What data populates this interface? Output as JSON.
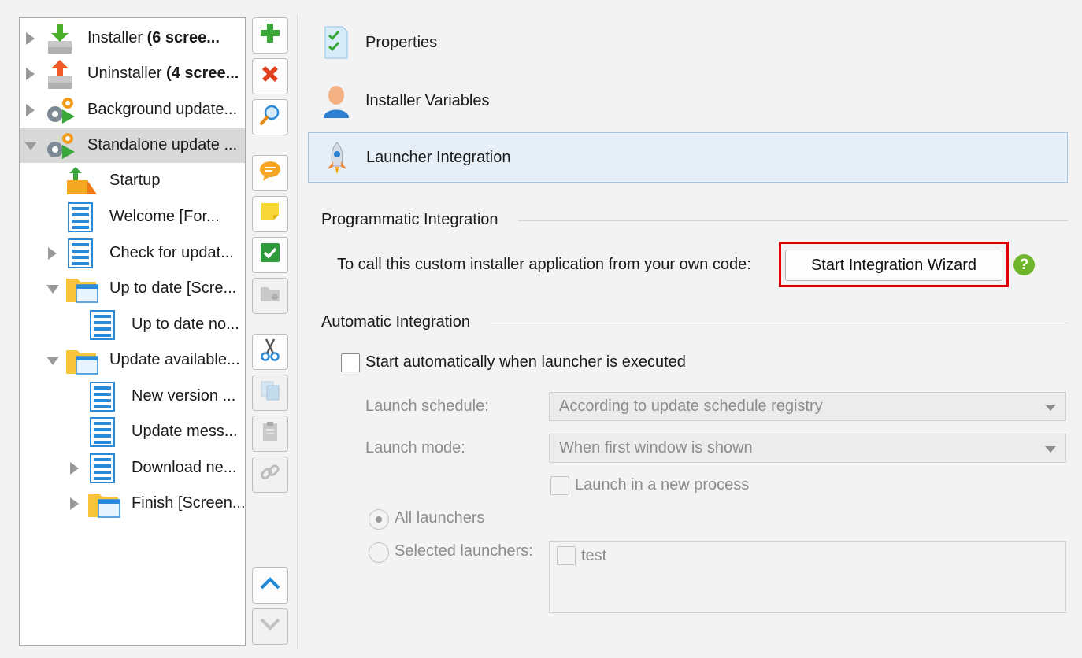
{
  "tree": {
    "items": [
      {
        "label": "Installer ",
        "bold": "(6 scree...",
        "icon": "installer-down-arrow-icon"
      },
      {
        "label": "Uninstaller ",
        "bold": "(4 scree...",
        "icon": "uninstaller-up-arrow-icon"
      },
      {
        "label": "Background update...",
        "icon": "gears-play-icon"
      },
      {
        "label": "Standalone update ...",
        "icon": "gears-play-icon",
        "selected": true
      },
      {
        "label": "Startup",
        "icon": "startup-box-icon"
      },
      {
        "label": "Welcome [For...",
        "icon": "screen-page-icon"
      },
      {
        "label": "Check for updat...",
        "icon": "screen-page-icon"
      },
      {
        "label": "Up to date [Scre...",
        "icon": "folder-window-icon"
      },
      {
        "label": "Up to date no...",
        "icon": "screen-page-icon"
      },
      {
        "label": "Update available...",
        "icon": "folder-window-icon"
      },
      {
        "label": "New version ...",
        "icon": "screen-page-icon"
      },
      {
        "label": "Update mess...",
        "icon": "screen-page-icon"
      },
      {
        "label": "Download ne...",
        "icon": "screen-page-icon"
      },
      {
        "label": "Finish [Screen...",
        "icon": "folder-window-icon"
      }
    ]
  },
  "toolbar": {
    "buttons": [
      "add-icon",
      "delete-icon",
      "search-icon",
      "comment-icon",
      "note-icon",
      "check-icon",
      "folder-disabled-icon",
      "cut-icon",
      "copy-icon",
      "paste-icon",
      "link-icon",
      "move-up-icon",
      "move-down-icon"
    ]
  },
  "nav": {
    "properties": "Properties",
    "variables": "Installer Variables",
    "launcher": "Launcher Integration"
  },
  "programmatic": {
    "title": "Programmatic Integration",
    "description": "To call this custom installer application from your own code:",
    "button": "Start Integration Wizard",
    "help": "?"
  },
  "automatic": {
    "title": "Automatic Integration",
    "start_checkbox": "Start automatically when launcher is executed",
    "schedule_label": "Launch schedule:",
    "schedule_value": "According to update schedule registry",
    "mode_label": "Launch mode:",
    "mode_value": "When first window is shown",
    "new_process": "Launch in a new process",
    "all_launchers": "All launchers",
    "selected_launchers": "Selected launchers:",
    "launchers": [
      "test"
    ]
  },
  "colors": {
    "highlight": "#e00000",
    "selected_bg": "#e6eff8",
    "help_green": "#6fb52c"
  }
}
